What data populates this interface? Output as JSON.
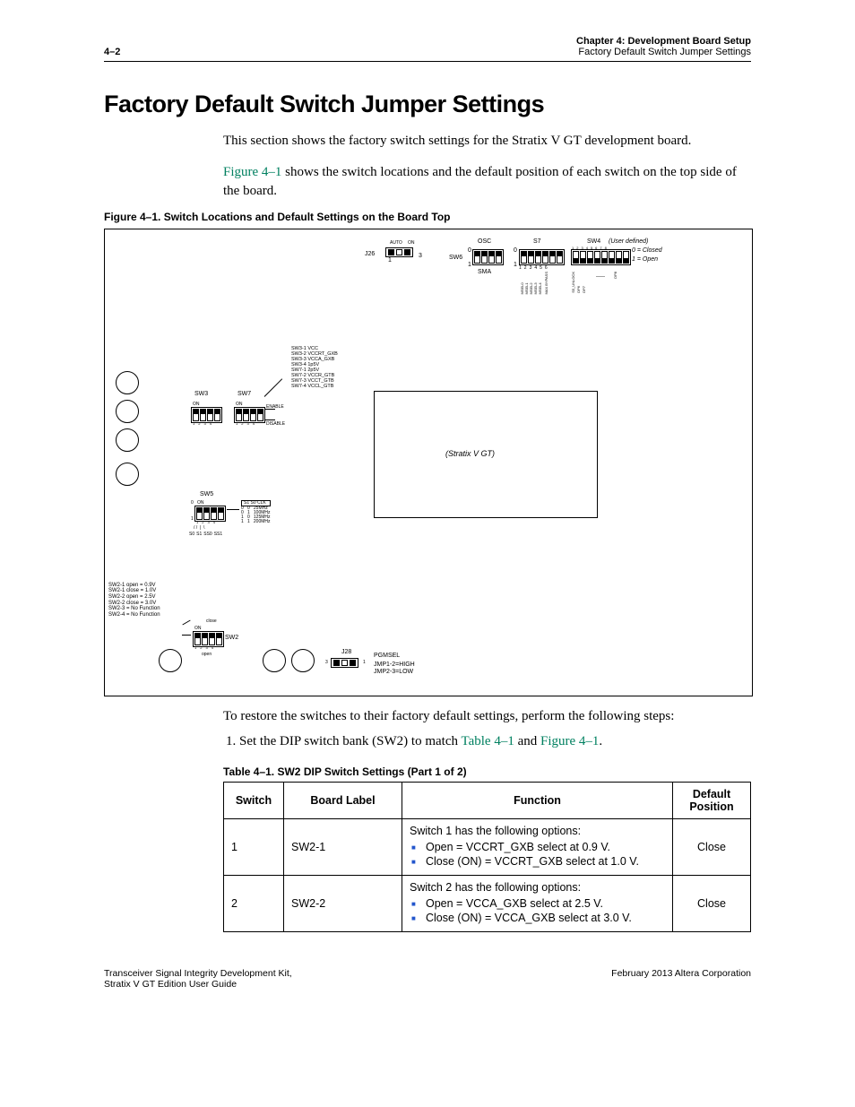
{
  "header": {
    "page_num": "4–2",
    "chapter": "Chapter 4:  Development Board Setup",
    "section_ref": "Factory Default Switch Jumper Settings"
  },
  "h1": "Factory Default Switch Jumper Settings",
  "intro_p1": "This section shows the factory switch settings for the Stratix V GT development board.",
  "intro_fig_link": "Figure 4–1",
  "intro_p2_rest": " shows the switch locations and the default position of each switch on the top side of the board.",
  "fig_caption": "Figure 4–1. Switch Locations and Default Settings on the Board Top",
  "figure": {
    "chip_label": "(Stratix V GT)",
    "j26": {
      "label": "J26",
      "auto": "AUTO",
      "on": "ON",
      "pins": [
        "1",
        "3"
      ]
    },
    "sw6": {
      "label": "SW6",
      "top": "OSC",
      "bottom": "SMA",
      "left": [
        "0",
        "1"
      ]
    },
    "s7": {
      "label": "S7",
      "left": [
        "0",
        "1"
      ],
      "pins": [
        "1",
        "2",
        "3",
        "4",
        "5",
        "6"
      ],
      "signals": [
        "MSEL0",
        "MSEL1",
        "MSEL2",
        "MSEL3",
        "MSEL4",
        "MAX BYPASS"
      ]
    },
    "sw4": {
      "label": "SW4",
      "note": "(User defined)",
      "closed": "0 = Closed",
      "open": "1 = Open",
      "pins": [
        "1",
        "2",
        "3",
        "4",
        "5",
        "6",
        "7",
        "8"
      ],
      "signals_left": [
        "S5_UNLOCK",
        "DP6",
        "DP7"
      ],
      "signals_right": [
        "DP8"
      ]
    },
    "sw3": {
      "label": "SW3",
      "on": "ON",
      "pins": [
        "1",
        "2",
        "3",
        "4"
      ]
    },
    "sw7": {
      "label": "SW7",
      "on": "ON",
      "pins": [
        "1",
        "2",
        "3",
        "4"
      ],
      "enable": "ENABLE",
      "disable": "DISABLE"
    },
    "sw37_legend": [
      "SW3-1 VCC",
      "SW3-2 VCCRT_GXB",
      "SW3-3 VCCA_GXB",
      "SW3-4 1p5V",
      "SW7-1 2p5V",
      "SW7-2 VCCR_GTB",
      "SW7-3 VCCT_GTB",
      "SW7-4 VCCL_GTB"
    ],
    "sw5": {
      "label": "SW5",
      "on": "ON",
      "left": [
        "0",
        "1"
      ],
      "pins": [
        "1",
        "2",
        "3",
        "4"
      ],
      "bottom_labels": [
        "S0",
        "S1",
        "SS0",
        "SS1"
      ],
      "legend_header": "S1 S0 CLK",
      "legend": [
        "0   0   25MHz",
        "0   1   100MHz",
        "1   0   125MHz",
        "1   1   200MHz"
      ]
    },
    "sw2": {
      "label": "SW2",
      "on": "ON",
      "pins": [
        "1",
        "2",
        "3",
        "4"
      ],
      "close": "close",
      "open": "open",
      "legend": [
        "SW2-1 open = 0.9V",
        "SW2-1 close = 1.0V",
        "SW2-2 open = 2.5V",
        "SW2-2 close = 3.0V",
        "SW2-3 = No Function",
        "SW2-4 = No Function"
      ]
    },
    "j28": {
      "label": "J28",
      "pins": [
        "3",
        "1"
      ],
      "pgmsel": "PGMSEL",
      "l1": "JMP1-2=HIGH",
      "l2": "JMP2-3=LOW"
    }
  },
  "restore_text": "To restore the switches to their factory default settings, perform the following steps:",
  "step1_a": "Set the DIP switch bank (SW2) to match ",
  "step1_link1": "Table 4–1",
  "step1_mid": " and ",
  "step1_link2": "Figure 4–1",
  "step1_end": ".",
  "table_caption": "Table 4–1. SW2 DIP Switch Settings  (Part 1 of 2)",
  "table": {
    "headers": {
      "switch": "Switch",
      "label": "Board Label",
      "function": "Function",
      "default": "Default Position"
    },
    "rows": [
      {
        "switch": "1",
        "label": "SW2-1",
        "intro": "Switch 1 has the following options:",
        "opts": [
          "Open = VCCRT_GXB select at 0.9 V.",
          "Close (ON) = VCCRT_GXB select at 1.0 V."
        ],
        "default": "Close"
      },
      {
        "switch": "2",
        "label": "SW2-2",
        "intro": "Switch 2 has the following options:",
        "opts": [
          "Open = VCCA_GXB select at 2.5 V.",
          "Close (ON) = VCCA_GXB select at 3.0 V."
        ],
        "default": "Close"
      }
    ]
  },
  "footer": {
    "left1": "Transceiver Signal Integrity Development Kit,",
    "left2": "Stratix V GT Edition User Guide",
    "right": "February 2013   Altera Corporation"
  }
}
